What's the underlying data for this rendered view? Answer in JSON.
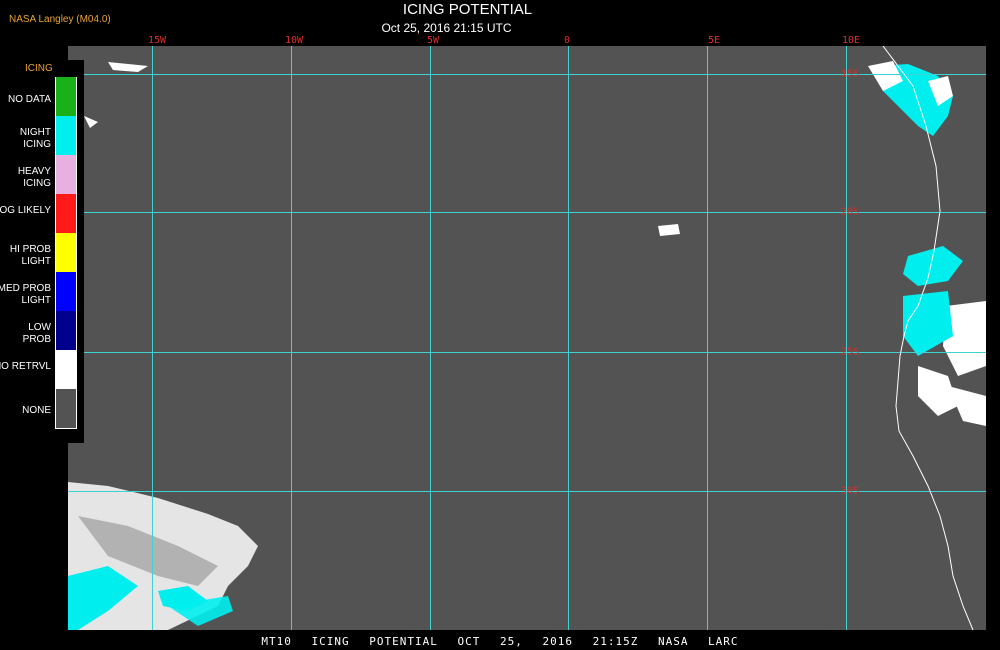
{
  "header": {
    "credit": "NASA Langley (M04.0)",
    "title": "ICING POTENTIAL",
    "timestamp": "Oct 25, 2016 21:15 UTC"
  },
  "map": {
    "ocean_color": "#535353",
    "grid_color": "#3fd2d2",
    "coastline_color": "#ffffff",
    "longitude_labels": [
      "15W",
      "10W",
      "5W",
      "0",
      "5E",
      "10E"
    ],
    "latitude_labels": [
      "15S",
      "20S",
      "25S",
      "30S"
    ]
  },
  "legend": {
    "title": "ICING",
    "items": [
      {
        "label": "NO DATA",
        "color": "#1ab01a"
      },
      {
        "label": "NIGHT ICING",
        "color": "#00eeee"
      },
      {
        "label": "HEAVY ICING",
        "color": "#e8b0e0"
      },
      {
        "label": "MOG LIKELY",
        "color": "#ff1a1a"
      },
      {
        "label": "HI PROB LIGHT",
        "color": "#ffff00"
      },
      {
        "label": "MED PROB LIGHT",
        "color": "#0000ff"
      },
      {
        "label": "LOW PROB",
        "color": "#00008c"
      },
      {
        "label": "NO RETRVL",
        "color": "#ffffff"
      },
      {
        "label": "NONE",
        "color": "#535353"
      }
    ]
  },
  "footer": {
    "text": "MT10 ICING POTENTIAL OCT 25, 2016 21:15Z NASA LARC"
  }
}
